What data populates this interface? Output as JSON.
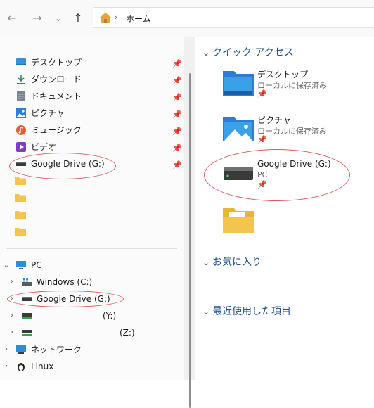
{
  "address": {
    "home_icon": "home-icon",
    "separator": "›",
    "crumb": "ホーム"
  },
  "nav": {
    "back": "←",
    "forward": "→",
    "recent": "⌄",
    "up": "↑"
  },
  "sidebar": {
    "quick": [
      {
        "label": "デスクトップ",
        "icon": "desktop-icon",
        "color": "#3b8fd6"
      },
      {
        "label": "ダウンロード",
        "icon": "download-icon",
        "color": "#2c8a6a"
      },
      {
        "label": "ドキュメント",
        "icon": "document-icon",
        "color": "#7a8593"
      },
      {
        "label": "ピクチャ",
        "icon": "pictures-icon",
        "color": "#2c7dd6"
      },
      {
        "label": "ミュージック",
        "icon": "music-icon",
        "color": "#e0603a"
      },
      {
        "label": "ビデオ",
        "icon": "video-icon",
        "color": "#7b3fc4"
      },
      {
        "label": "Google Drive (G:)",
        "icon": "drive-icon",
        "color": "#3a3a3a"
      }
    ],
    "tree": {
      "pc_label": "PC",
      "windows_label": "Windows (C:)",
      "gdrive_label": "Google Drive (G:)",
      "y_label": "(Y:)",
      "z_label": "(Z:)",
      "network_label": "ネットワーク",
      "linux_label": "Linux"
    }
  },
  "main": {
    "quick_access_title": "クイック アクセス",
    "tiles": [
      {
        "title": "デスクトップ",
        "sub": "ローカルに保存済み",
        "icon": "desktop-folder-icon"
      },
      {
        "title": "ピクチャ",
        "sub": "ローカルに保存済み",
        "icon": "pictures-folder-icon"
      },
      {
        "title": "Google Drive (G:)",
        "sub": "PC",
        "icon": "drive-icon"
      }
    ],
    "favorites_title": "お気に入り",
    "recent_title": "最近使用した項目"
  },
  "colors": {
    "accent": "#1a4e8a",
    "highlight": "#e05a5a",
    "folder": "#f3c44e"
  }
}
